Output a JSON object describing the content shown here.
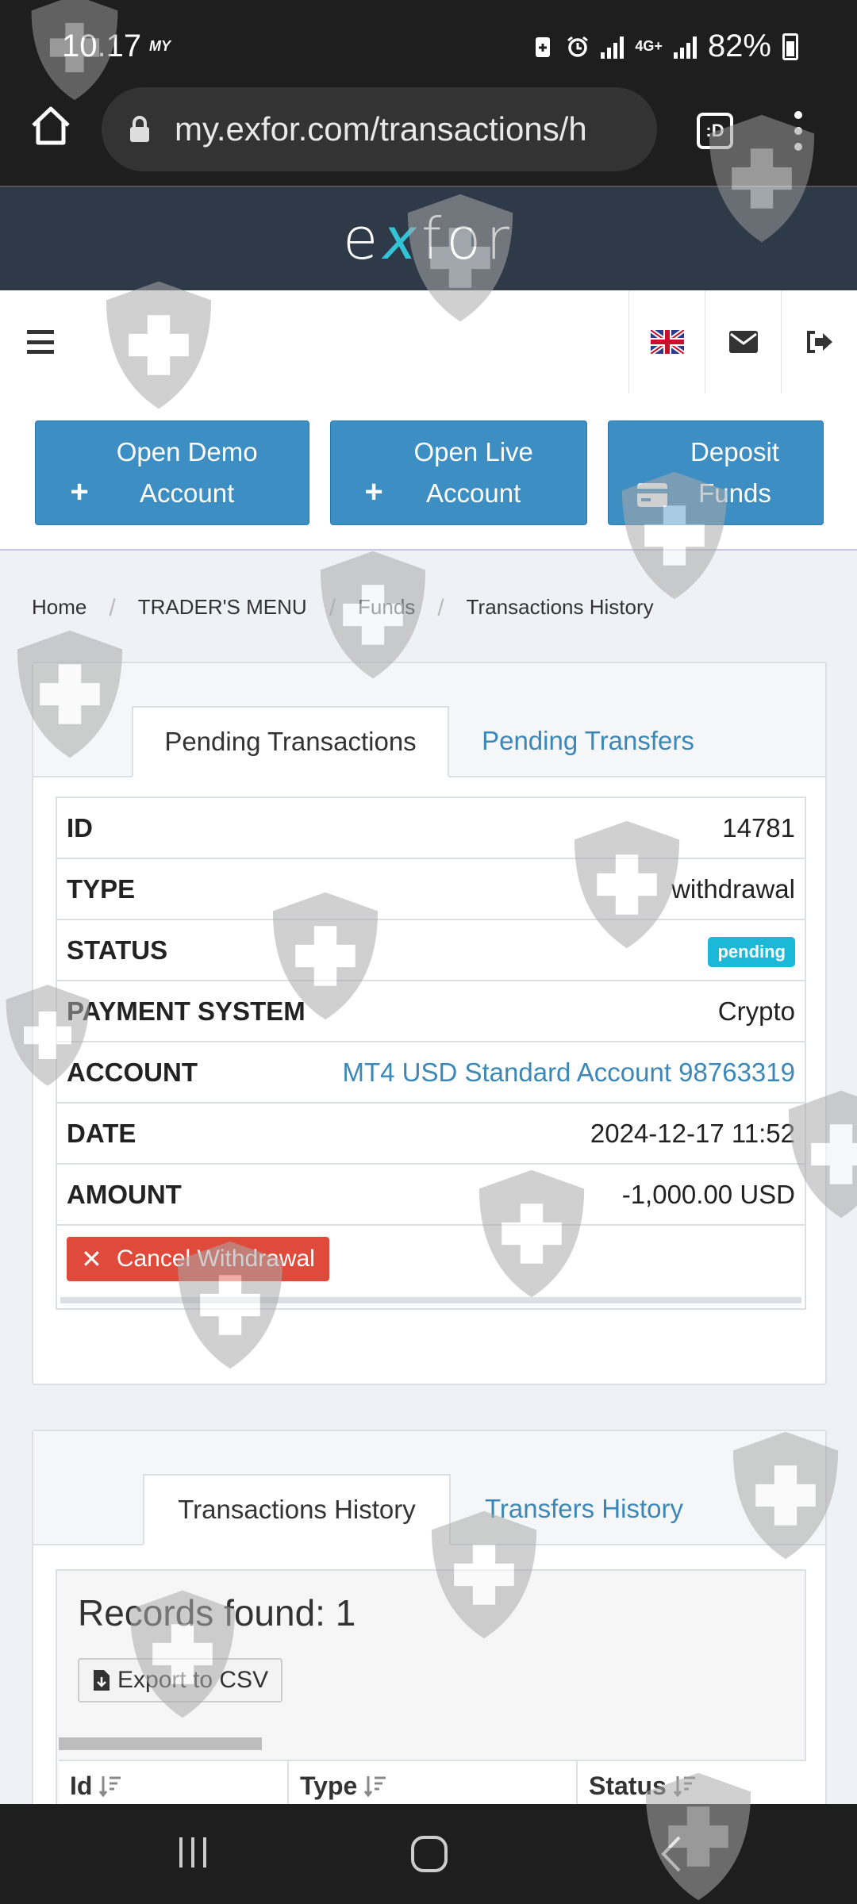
{
  "status_bar": {
    "time": "10.17",
    "carrier": "MY",
    "battery": "82%",
    "network": "4G+"
  },
  "browser": {
    "url": "my.exfor.com/transactions/h",
    "tabs_label": ":D"
  },
  "site": {
    "logo_prefix": "e",
    "logo_x": "x",
    "logo_suffix": "for"
  },
  "actions": {
    "open_demo": "Open Demo Account",
    "open_live": "Open Live Account",
    "deposit": "Deposit Funds"
  },
  "breadcrumb": [
    "Home",
    "TRADER'S MENU",
    "Funds",
    "Transactions History"
  ],
  "pending_panel": {
    "tab_active": "Pending Transactions",
    "tab_inactive": "Pending Transfers",
    "rows": [
      {
        "key": "ID",
        "value": "14781"
      },
      {
        "key": "TYPE",
        "value": "withdrawal"
      },
      {
        "key": "STATUS",
        "value": "pending"
      },
      {
        "key": "PAYMENT SYSTEM",
        "value": "Crypto"
      },
      {
        "key": "ACCOUNT",
        "value": "MT4 USD Standard Account 98763319"
      },
      {
        "key": "DATE",
        "value": "2024-12-17 11:52"
      },
      {
        "key": "AMOUNT",
        "value": "-1,000.00 USD"
      }
    ],
    "cancel_label": "Cancel Withdrawal"
  },
  "history_panel": {
    "tab_active": "Transactions History",
    "tab_inactive": "Transfers History",
    "records_found": "Records found: 1",
    "export_label": "Export to CSV",
    "columns": [
      "Id",
      "Type",
      "Status"
    ]
  },
  "colors": {
    "accent": "#3d8ec3",
    "header": "#2f3a48",
    "badge": "#1cb8d8",
    "danger": "#e04a3a",
    "link": "#3b88b8"
  }
}
